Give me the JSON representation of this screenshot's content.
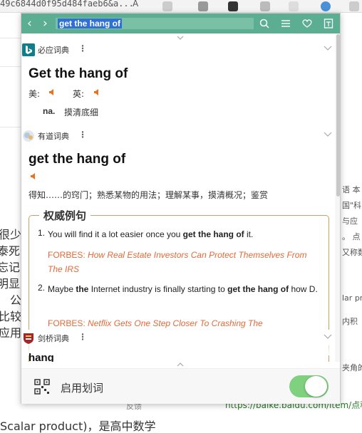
{
  "background": {
    "url_fragment": "49c6844d0f95d484faeb6&a...",
    "aa": "A",
    "left_lines": [
      "很少",
      "泰死于",
      "忘记了",
      "明显是",
      "公",
      "比较",
      "应用。"
    ],
    "right_lines": [
      "语 本",
      "国\"科",
      "与应",
      "。 点",
      "又称数",
      "lar pro",
      "内积",
      "夹角的"
    ],
    "bottom_text": "Scalar product)，是高中数学",
    "link": "https://baike.baidu.com/item/点积/",
    "feedback": "反馈"
  },
  "popup": {
    "search": {
      "value": "get the hang of"
    },
    "icons": [
      "back-icon",
      "forward-icon",
      "search-icon",
      "menu-icon",
      "heart-icon",
      "bookmark-icon"
    ],
    "bing": {
      "name": "必应词典",
      "more": "⋮",
      "word": "Get the hang of",
      "us_label": "美:",
      "uk_label": "英:",
      "pos": "na.",
      "meaning": "摸清底细"
    },
    "youdao": {
      "name": "有道词典",
      "more": "⋮",
      "word": "get the hang of",
      "meaning": "得知……的窍门；熟悉某物的用法；理解某事，摸清概况；鉴赏",
      "examples_title": "权威例句",
      "examples": [
        {
          "num": "1.",
          "pre": "You will find it a lot easier once you ",
          "bold": "get the hang of",
          "post": " it.",
          "src_name": "FORBES:",
          "src_title": "How Real Estate Investors Can Protect Themselves From The IRS"
        },
        {
          "num": "2.",
          "pre1": "Maybe ",
          "bold1": "the",
          "pre2": " Internet industry is finally starting to ",
          "bold": "get the hang of",
          "post": " how D.",
          "src_name": "FORBES:",
          "src_title": "Netflix Gets One Step Closer To Crashing The"
        }
      ]
    },
    "cambridge": {
      "name": "剑桥词典",
      "more": "⋮",
      "word": "hang"
    },
    "footer": {
      "enable_label": "启用划词",
      "toggle_on": true
    }
  },
  "colors": {
    "topbar": "#5bae92",
    "accent_orange": "#e06a3a",
    "toggle": "#7fd07f"
  }
}
